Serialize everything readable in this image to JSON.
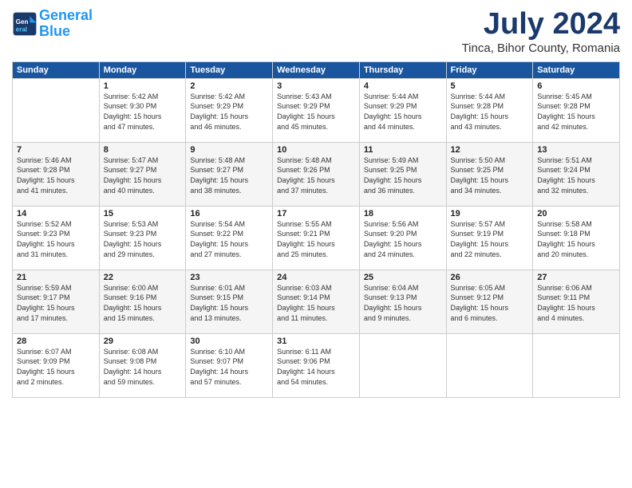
{
  "logo": {
    "line1": "General",
    "line2": "Blue"
  },
  "title": "July 2024",
  "subtitle": "Tinca, Bihor County, Romania",
  "days_header": [
    "Sunday",
    "Monday",
    "Tuesday",
    "Wednesday",
    "Thursday",
    "Friday",
    "Saturday"
  ],
  "weeks": [
    [
      {
        "day": "",
        "info": ""
      },
      {
        "day": "1",
        "info": "Sunrise: 5:42 AM\nSunset: 9:30 PM\nDaylight: 15 hours\nand 47 minutes."
      },
      {
        "day": "2",
        "info": "Sunrise: 5:42 AM\nSunset: 9:29 PM\nDaylight: 15 hours\nand 46 minutes."
      },
      {
        "day": "3",
        "info": "Sunrise: 5:43 AM\nSunset: 9:29 PM\nDaylight: 15 hours\nand 45 minutes."
      },
      {
        "day": "4",
        "info": "Sunrise: 5:44 AM\nSunset: 9:29 PM\nDaylight: 15 hours\nand 44 minutes."
      },
      {
        "day": "5",
        "info": "Sunrise: 5:44 AM\nSunset: 9:28 PM\nDaylight: 15 hours\nand 43 minutes."
      },
      {
        "day": "6",
        "info": "Sunrise: 5:45 AM\nSunset: 9:28 PM\nDaylight: 15 hours\nand 42 minutes."
      }
    ],
    [
      {
        "day": "7",
        "info": "Sunrise: 5:46 AM\nSunset: 9:28 PM\nDaylight: 15 hours\nand 41 minutes."
      },
      {
        "day": "8",
        "info": "Sunrise: 5:47 AM\nSunset: 9:27 PM\nDaylight: 15 hours\nand 40 minutes."
      },
      {
        "day": "9",
        "info": "Sunrise: 5:48 AM\nSunset: 9:27 PM\nDaylight: 15 hours\nand 38 minutes."
      },
      {
        "day": "10",
        "info": "Sunrise: 5:48 AM\nSunset: 9:26 PM\nDaylight: 15 hours\nand 37 minutes."
      },
      {
        "day": "11",
        "info": "Sunrise: 5:49 AM\nSunset: 9:25 PM\nDaylight: 15 hours\nand 36 minutes."
      },
      {
        "day": "12",
        "info": "Sunrise: 5:50 AM\nSunset: 9:25 PM\nDaylight: 15 hours\nand 34 minutes."
      },
      {
        "day": "13",
        "info": "Sunrise: 5:51 AM\nSunset: 9:24 PM\nDaylight: 15 hours\nand 32 minutes."
      }
    ],
    [
      {
        "day": "14",
        "info": "Sunrise: 5:52 AM\nSunset: 9:23 PM\nDaylight: 15 hours\nand 31 minutes."
      },
      {
        "day": "15",
        "info": "Sunrise: 5:53 AM\nSunset: 9:23 PM\nDaylight: 15 hours\nand 29 minutes."
      },
      {
        "day": "16",
        "info": "Sunrise: 5:54 AM\nSunset: 9:22 PM\nDaylight: 15 hours\nand 27 minutes."
      },
      {
        "day": "17",
        "info": "Sunrise: 5:55 AM\nSunset: 9:21 PM\nDaylight: 15 hours\nand 25 minutes."
      },
      {
        "day": "18",
        "info": "Sunrise: 5:56 AM\nSunset: 9:20 PM\nDaylight: 15 hours\nand 24 minutes."
      },
      {
        "day": "19",
        "info": "Sunrise: 5:57 AM\nSunset: 9:19 PM\nDaylight: 15 hours\nand 22 minutes."
      },
      {
        "day": "20",
        "info": "Sunrise: 5:58 AM\nSunset: 9:18 PM\nDaylight: 15 hours\nand 20 minutes."
      }
    ],
    [
      {
        "day": "21",
        "info": "Sunrise: 5:59 AM\nSunset: 9:17 PM\nDaylight: 15 hours\nand 17 minutes."
      },
      {
        "day": "22",
        "info": "Sunrise: 6:00 AM\nSunset: 9:16 PM\nDaylight: 15 hours\nand 15 minutes."
      },
      {
        "day": "23",
        "info": "Sunrise: 6:01 AM\nSunset: 9:15 PM\nDaylight: 15 hours\nand 13 minutes."
      },
      {
        "day": "24",
        "info": "Sunrise: 6:03 AM\nSunset: 9:14 PM\nDaylight: 15 hours\nand 11 minutes."
      },
      {
        "day": "25",
        "info": "Sunrise: 6:04 AM\nSunset: 9:13 PM\nDaylight: 15 hours\nand 9 minutes."
      },
      {
        "day": "26",
        "info": "Sunrise: 6:05 AM\nSunset: 9:12 PM\nDaylight: 15 hours\nand 6 minutes."
      },
      {
        "day": "27",
        "info": "Sunrise: 6:06 AM\nSunset: 9:11 PM\nDaylight: 15 hours\nand 4 minutes."
      }
    ],
    [
      {
        "day": "28",
        "info": "Sunrise: 6:07 AM\nSunset: 9:09 PM\nDaylight: 15 hours\nand 2 minutes."
      },
      {
        "day": "29",
        "info": "Sunrise: 6:08 AM\nSunset: 9:08 PM\nDaylight: 14 hours\nand 59 minutes."
      },
      {
        "day": "30",
        "info": "Sunrise: 6:10 AM\nSunset: 9:07 PM\nDaylight: 14 hours\nand 57 minutes."
      },
      {
        "day": "31",
        "info": "Sunrise: 6:11 AM\nSunset: 9:06 PM\nDaylight: 14 hours\nand 54 minutes."
      },
      {
        "day": "",
        "info": ""
      },
      {
        "day": "",
        "info": ""
      },
      {
        "day": "",
        "info": ""
      }
    ]
  ]
}
